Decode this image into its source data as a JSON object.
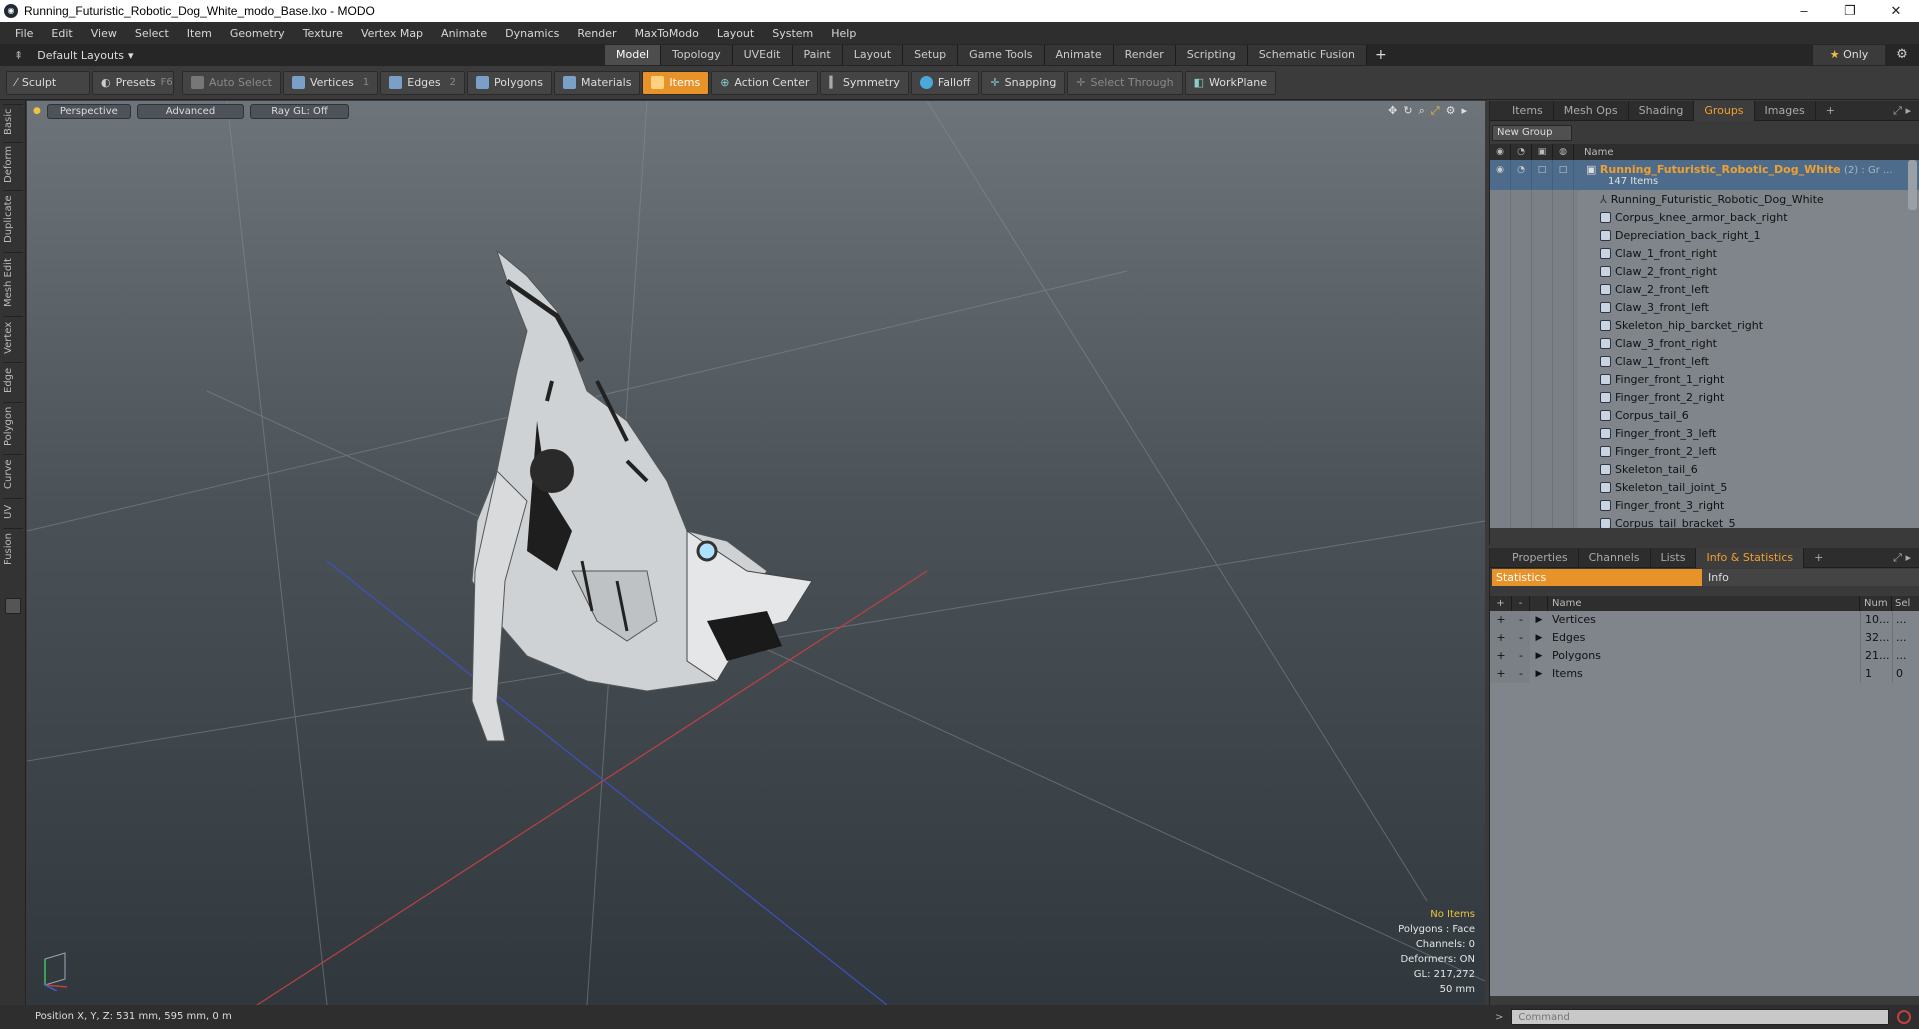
{
  "window": {
    "title": "Running_Futuristic_Robotic_Dog_White_modo_Base.lxo - MODO",
    "app_icon": "modo-logo-icon",
    "controls": [
      "–",
      "❐",
      "✕"
    ]
  },
  "menu": [
    "File",
    "Edit",
    "View",
    "Select",
    "Item",
    "Geometry",
    "Texture",
    "Vertex Map",
    "Animate",
    "Dynamics",
    "Render",
    "MaxToModo",
    "Layout",
    "System",
    "Help"
  ],
  "layout_dropdown": "Default Layouts",
  "mode_tabs": [
    "Model",
    "Topology",
    "UVEdit",
    "Paint",
    "Layout",
    "Setup",
    "Game Tools",
    "Animate",
    "Render",
    "Scripting",
    "Schematic Fusion"
  ],
  "active_mode_tab": "Model",
  "only_button": {
    "star": "★",
    "label": "Only"
  },
  "toolbar": {
    "sculpt": "Sculpt",
    "presets": "Presets",
    "presets_key": "F6",
    "auto_select": "Auto Select",
    "vertices": "Vertices",
    "vertices_num": "1",
    "edges": "Edges",
    "edges_num": "2",
    "polygons": "Polygons",
    "materials": "Materials",
    "items": "Items",
    "action_center": "Action Center",
    "symmetry": "Symmetry",
    "falloff": "Falloff",
    "snapping": "Snapping",
    "select_through": "Select Through",
    "workplane": "WorkPlane"
  },
  "left_tabs": [
    "Basic",
    "Deform",
    "Duplicate",
    "Mesh Edit",
    "Vertex",
    "Edge",
    "Polygon",
    "Curve",
    "UV",
    "Fusion"
  ],
  "viewport": {
    "buttons": [
      "Perspective",
      "Advanced",
      "Ray GL: Off"
    ],
    "hud": {
      "selection": "No Items",
      "polygons": "Polygons : Face",
      "channels": "Channels: 0",
      "deformers": "Deformers: ON",
      "gl": "GL: 217,272",
      "scale": "50 mm"
    }
  },
  "groups_panel": {
    "tabs": [
      "Items",
      "Mesh Ops",
      "Shading",
      "Groups",
      "Images"
    ],
    "active_tab": "Groups",
    "new_group": "New Group",
    "header_name": "Name",
    "root": {
      "name": "Running_Futuristic_Robotic_Dog_White",
      "suffix": "(2) : Gr ...",
      "count": "147 Items"
    },
    "items": [
      "Running_Futuristic_Robotic_Dog_White",
      "Corpus_knee_armor_back_right",
      "Depreciation_back_right_1",
      "Claw_1_front_right",
      "Claw_2_front_right",
      "Claw_2_front_left",
      "Claw_3_front_left",
      "Skeleton_hip_barcket_right",
      "Claw_3_front_right",
      "Claw_1_front_left",
      "Finger_front_1_right",
      "Finger_front_2_right",
      "Corpus_tail_6",
      "Finger_front_3_left",
      "Finger_front_2_left",
      "Skeleton_tail_6",
      "Skeleton_tail_joint_5",
      "Finger_front_3_right",
      "Corpus_tail_bracket_5"
    ]
  },
  "stats_panel": {
    "tabs": [
      "Properties",
      "Channels",
      "Lists",
      "Info & Statistics"
    ],
    "active_tab": "Info & Statistics",
    "subtabs": [
      "Statistics",
      "Info"
    ],
    "columns": {
      "name": "Name",
      "num": "Num",
      "sel": "Sel"
    },
    "rows": [
      {
        "name": "Vertices",
        "num": "10...",
        "sel": "..."
      },
      {
        "name": "Edges",
        "num": "32...",
        "sel": "..."
      },
      {
        "name": "Polygons",
        "num": "21...",
        "sel": "..."
      },
      {
        "name": "Items",
        "num": "1",
        "sel": "0"
      }
    ]
  },
  "status": {
    "position": "Position X, Y, Z:   531 mm, 595 mm, 0 m"
  },
  "command": {
    "placeholder": "Command"
  }
}
